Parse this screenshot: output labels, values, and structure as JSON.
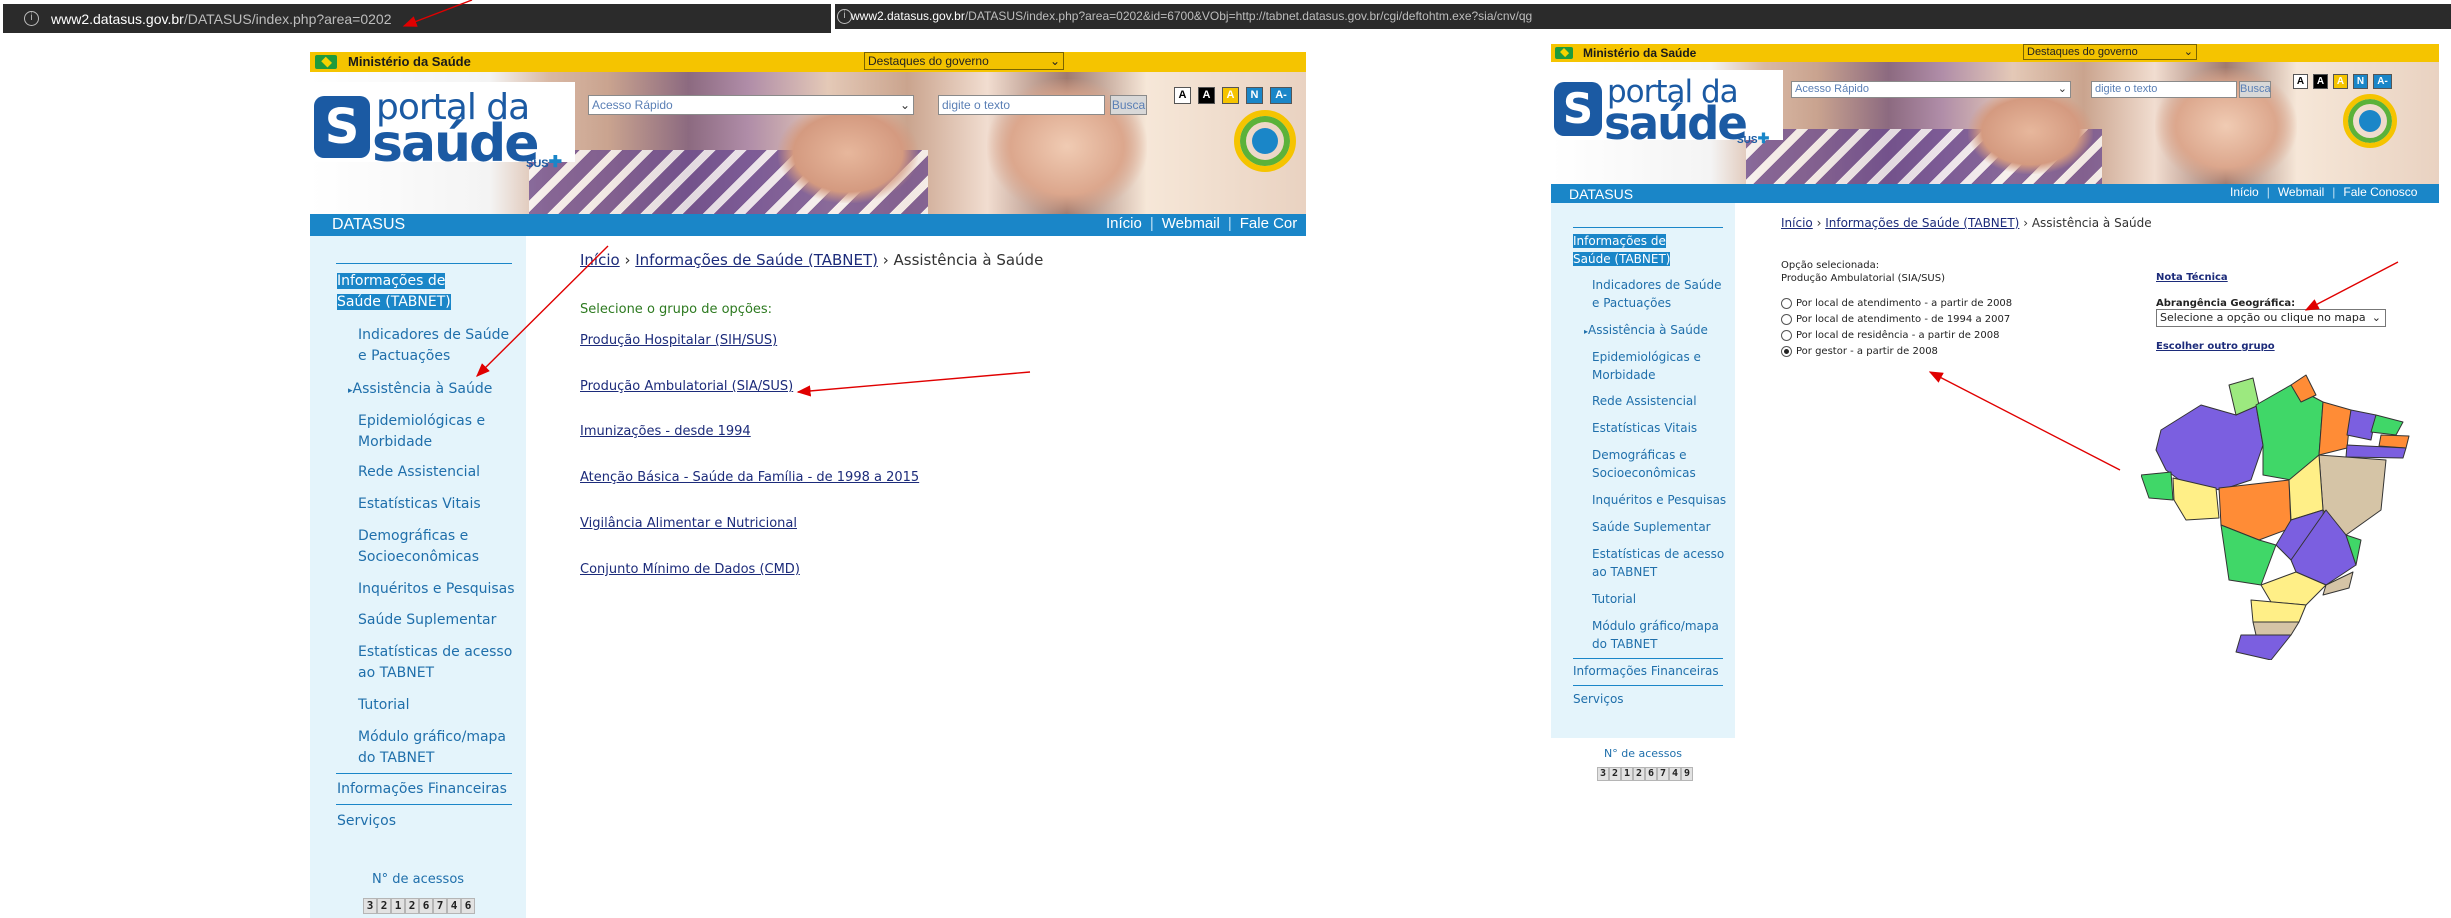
{
  "left_window": {
    "address_bar": {
      "host": "www2.datasus.gov.br",
      "path": "/DATASUS/index.php?area=0202"
    },
    "header": {
      "ministry_label": "Ministério da Saúde",
      "destaques_select": "Destaques do governo",
      "logo_portal": "portal da",
      "logo_saude": "saúde",
      "logo_sus": "SUS",
      "quick_access_placeholder": "Acesso Rápido",
      "search_placeholder": "digite o texto",
      "search_button": "Busca",
      "font_buttons": [
        "A",
        "A",
        "A",
        "N",
        "A-"
      ]
    },
    "blue_bar": {
      "section": "DATASUS",
      "nav_inicio": "Início",
      "nav_webmail": "Webmail",
      "nav_fale": "Fale Cor"
    },
    "sidebar": {
      "items": [
        "Informações de Saúde (TABNET)",
        "Indicadores de Saúde e Pactuações",
        "Assistência à Saúde",
        "Epidemiológicas e Morbidade",
        "Rede Assistencial",
        "Estatísticas Vitais",
        "Demográficas e Socioeconômicas",
        "Inquéritos e Pesquisas",
        "Saúde Suplementar",
        "Estatísticas de acesso ao TABNET",
        "Tutorial",
        "Módulo gráfico/mapa do TABNET",
        "Informações Financeiras",
        "Serviços"
      ]
    },
    "breadcrumb": {
      "inicio": "Início",
      "tabnet": "Informações de Saúde (TABNET)",
      "current": "Assistência à Saúde"
    },
    "group_label": "Selecione o grupo de opções:",
    "links": [
      "Produção Hospitalar (SIH/SUS)",
      "Produção Ambulatorial (SIA/SUS)",
      "Imunizações - desde 1994",
      "Atenção Básica - Saúde da Família - de 1998 a 2015",
      "Vigilância Alimentar e Nutricional",
      "Conjunto Mínimo de Dados (CMD)"
    ],
    "counter_label": "N° de acessos",
    "counter_digits": [
      "3",
      "2",
      "1",
      "2",
      "6",
      "7",
      "4",
      "6"
    ]
  },
  "right_window": {
    "address_bar": {
      "host": "www2.datasus.gov.br",
      "path": "/DATASUS/index.php?area=0202&id=6700&VObj=http://tabnet.datasus.gov.br/cgi/deftohtm.exe?sia/cnv/qg"
    },
    "header": {
      "ministry_label": "Ministério da Saúde",
      "destaques_select": "Destaques do governo",
      "logo_portal": "portal da",
      "logo_saude": "saúde",
      "logo_sus": "SUS",
      "quick_access_placeholder": "Acesso Rápido",
      "search_placeholder": "digite o texto",
      "search_button": "Busca",
      "font_buttons": [
        "A",
        "A",
        "A",
        "N",
        "A-"
      ]
    },
    "blue_bar": {
      "section": "DATASUS",
      "nav_inicio": "Início",
      "nav_webmail": "Webmail",
      "nav_fale": "Fale Conosco"
    },
    "sidebar": {
      "items": [
        "Informações de Saúde (TABNET)",
        "Indicadores de Saúde e Pactuações",
        "Assistência à Saúde",
        "Epidemiológicas e Morbidade",
        "Rede Assistencial",
        "Estatísticas Vitais",
        "Demográficas e Socioeconômicas",
        "Inquéritos e Pesquisas",
        "Saúde Suplementar",
        "Estatísticas de acesso ao TABNET",
        "Tutorial",
        "Módulo gráfico/mapa do TABNET",
        "Informações Financeiras",
        "Serviços"
      ]
    },
    "breadcrumb": {
      "inicio": "Início",
      "tabnet": "Informações de Saúde (TABNET)",
      "current": "Assistência à Saúde"
    },
    "selected_label": "Opção selecionada:",
    "selected_value": "Produção Ambulatorial (SIA/SUS)",
    "options": [
      "Por local de atendimento - a partir de 2008",
      "Por local de atendimento - de 1994 a 2007",
      "Por local de residência - a partir de 2008",
      "Por gestor - a partir de 2008"
    ],
    "selected_option_index": 3,
    "nota_tecnica": "Nota Técnica",
    "abrangencia_label": "Abrangência Geográfica:",
    "abrangencia_select": "Selecione a opção ou clique no mapa",
    "escolher_outro": "Escolher outro grupo",
    "counter_label": "N° de acessos",
    "counter_digits": [
      "3",
      "2",
      "1",
      "2",
      "6",
      "7",
      "4",
      "9"
    ]
  },
  "colors": {
    "yellow": "#f5c400",
    "blue_bar": "#1a86c8",
    "sidebar_bg": "#e4f4fb",
    "link": "#1c2b7a",
    "annotation_arrow": "#e00000"
  },
  "icons": [
    "info-icon",
    "brazil-flag-icon",
    "chevron-down-icon",
    "sus-cross-icon",
    "radio-button-icon",
    "brazil-map"
  ]
}
